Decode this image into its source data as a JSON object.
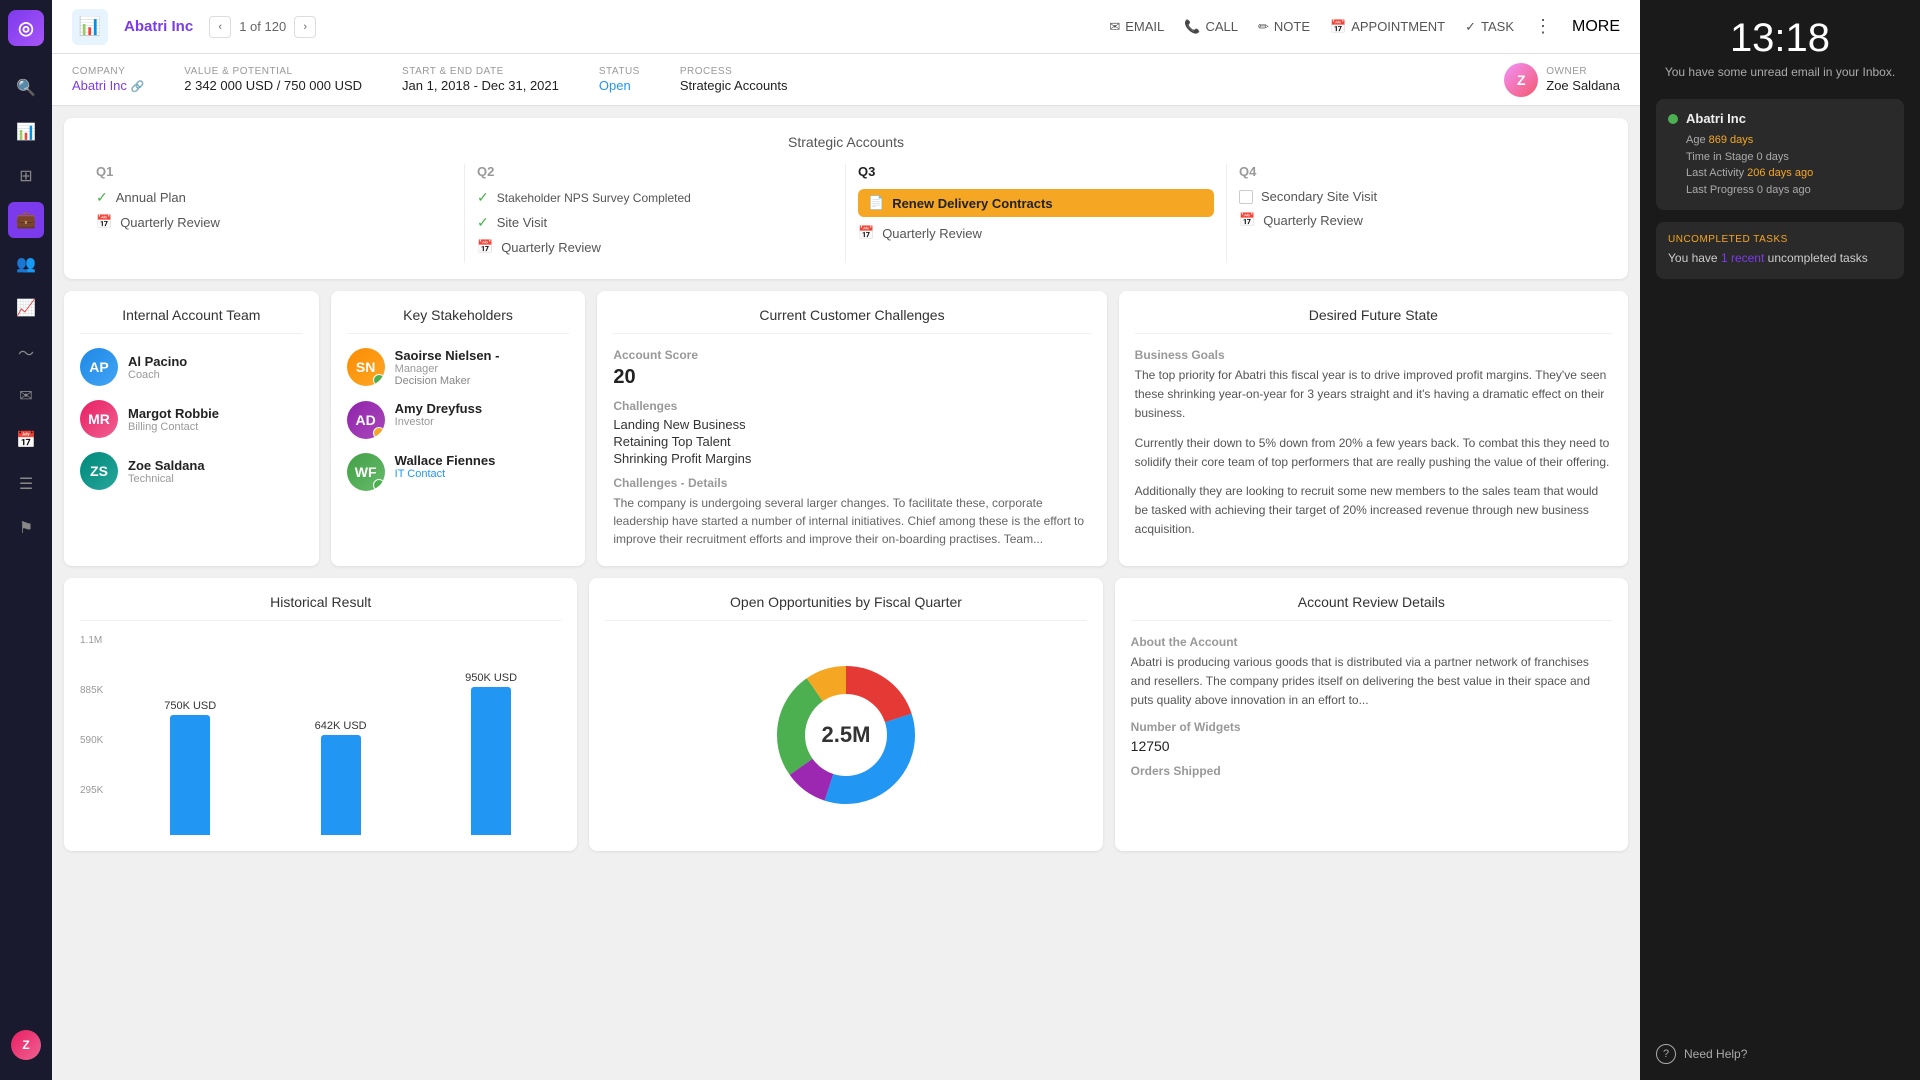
{
  "sidebar": {
    "logo": "◎",
    "icons": [
      {
        "name": "search-icon",
        "glyph": "🔍",
        "active": false
      },
      {
        "name": "chart-icon",
        "glyph": "📊",
        "active": false
      },
      {
        "name": "grid-icon",
        "glyph": "⊞",
        "active": false
      },
      {
        "name": "briefcase-icon",
        "glyph": "💼",
        "active": true
      },
      {
        "name": "people-icon",
        "glyph": "👥",
        "active": false
      },
      {
        "name": "bar-chart-icon",
        "glyph": "📈",
        "active": false
      },
      {
        "name": "pulse-icon",
        "glyph": "💓",
        "active": false
      },
      {
        "name": "mail-icon",
        "glyph": "✉",
        "active": false
      },
      {
        "name": "calendar-icon",
        "glyph": "📅",
        "active": false
      },
      {
        "name": "list-icon",
        "glyph": "☰",
        "active": false
      },
      {
        "name": "flag-icon",
        "glyph": "⚑",
        "active": false
      }
    ]
  },
  "topbar": {
    "account_name": "Abatri Inc",
    "nav_current": "1",
    "nav_total": "120",
    "actions": [
      {
        "name": "email-action",
        "label": "EMAIL",
        "icon": "✉"
      },
      {
        "name": "call-action",
        "label": "CALL",
        "icon": "📞"
      },
      {
        "name": "note-action",
        "label": "NOTE",
        "icon": "✏"
      },
      {
        "name": "appointment-action",
        "label": "APPOINTMENT",
        "icon": "📅"
      },
      {
        "name": "task-action",
        "label": "TASK",
        "icon": "✓"
      },
      {
        "name": "more-action",
        "label": "MORE",
        "icon": "⋮"
      }
    ]
  },
  "metadata": {
    "company_label": "COMPANY",
    "company_value": "Abatri Inc",
    "value_label": "VALUE & POTENTIAL",
    "value_value": "2 342 000 USD / 750 000 USD",
    "date_label": "START & END DATE",
    "date_value": "Jan 1, 2018 - Dec 31, 2021",
    "status_label": "STATUS",
    "status_value": "Open",
    "process_label": "PROCESS",
    "process_value": "Strategic Accounts",
    "owner_label": "OWNER",
    "owner_value": "Zoe Saldana"
  },
  "strategic": {
    "title": "Strategic Accounts",
    "quarters": [
      {
        "label": "Q1",
        "active": false,
        "items": [
          {
            "type": "check",
            "label": "Annual Plan"
          },
          {
            "type": "calendar",
            "label": "Quarterly Review"
          }
        ]
      },
      {
        "label": "Q2",
        "active": false,
        "items": [
          {
            "type": "check",
            "label": "Stakeholder NPS Survey Completed"
          },
          {
            "type": "check",
            "label": "Site Visit"
          },
          {
            "type": "calendar",
            "label": "Quarterly Review"
          }
        ]
      },
      {
        "label": "Q3",
        "active": true,
        "items": [
          {
            "type": "highlight",
            "label": "Renew Delivery Contracts"
          },
          {
            "type": "calendar",
            "label": "Quarterly Review"
          }
        ]
      },
      {
        "label": "Q4",
        "active": false,
        "items": [
          {
            "type": "empty",
            "label": "Secondary Site Visit"
          },
          {
            "type": "calendar",
            "label": "Quarterly Review"
          }
        ]
      }
    ]
  },
  "internal_team": {
    "title": "Internal Account Team",
    "members": [
      {
        "name": "Al Pacino",
        "role": "Coach",
        "initials": "AP",
        "color": "av-blue"
      },
      {
        "name": "Margot Robbie",
        "role": "Billing Contact",
        "initials": "MR",
        "color": "av-pink"
      },
      {
        "name": "Zoe Saldana",
        "role": "Technical",
        "initials": "ZS",
        "color": "av-teal"
      }
    ]
  },
  "key_stakeholders": {
    "title": "Key Stakeholders",
    "members": [
      {
        "name": "Saoirse Nielsen",
        "title": "Manager",
        "tag": "Decision Maker",
        "initials": "SN",
        "color": "av-orange",
        "badge_color": "#4CAF50"
      },
      {
        "name": "Amy Dreyfuss",
        "title": "Investor",
        "tag": "",
        "initials": "AD",
        "color": "av-purple",
        "badge_color": "#f5a623"
      },
      {
        "name": "Wallace Fiennes",
        "title": "IT Contact",
        "tag": "",
        "initials": "WF",
        "color": "av-green",
        "badge_color": "#4CAF50"
      }
    ]
  },
  "challenges": {
    "title": "Current Customer Challenges",
    "account_score_label": "Account Score",
    "account_score": "20",
    "challenges_label": "Challenges",
    "challenges_list": [
      "Landing New Business",
      "Retaining Top Talent",
      "Shrinking Profit Margins"
    ],
    "details_label": "Challenges - Details",
    "details_text": "The company is undergoing several larger changes. To facilitate these, corporate leadership have started a number of internal initiatives. Chief among these is the effort to improve their recruitment efforts and improve their on-boarding practises. Team..."
  },
  "desired_future": {
    "title": "Desired Future State",
    "goals_label": "Business Goals",
    "goals_text1": "The top priority for Abatri this fiscal year is to drive improved profit margins. They've seen these shrinking year-on-year for 3 years straight and it's having a dramatic effect on their business.",
    "goals_text2": "Currently their down to 5% down from 20% a few years back. To combat this they need to solidify their core team of top performers that are really pushing the value of their offering.",
    "goals_text3": "Additionally they are looking to recruit some new members to the sales team that would be tasked with achieving their target of 20% increased revenue through new business acquisition."
  },
  "historical": {
    "title": "Historical Result",
    "bars": [
      {
        "label_top": "750K USD",
        "label_bottom": "",
        "height_pct": 68
      },
      {
        "label_top": "642K USD",
        "label_bottom": "",
        "height_pct": 58
      },
      {
        "label_top": "950K USD",
        "label_bottom": "",
        "height_pct": 86
      }
    ],
    "y_labels": [
      "1.1M",
      "885K",
      "590K",
      "295K",
      ""
    ]
  },
  "opportunities": {
    "title": "Open Opportunities by Fiscal Quarter",
    "total": "2.5M",
    "segments": [
      {
        "color": "#e53935",
        "pct": 20
      },
      {
        "color": "#2196F3",
        "pct": 35
      },
      {
        "color": "#9c27b0",
        "pct": 10
      },
      {
        "color": "#4CAF50",
        "pct": 25
      },
      {
        "color": "#f5a623",
        "pct": 10
      }
    ]
  },
  "account_review": {
    "title": "Account Review Details",
    "about_label": "About the Account",
    "about_text": "Abatri is producing various goods that is distributed via a partner network of franchises and resellers. The company prides itself on delivering the best value in their space and puts quality above innovation in an effort to...",
    "widgets_label": "Number of Widgets",
    "widgets_value": "12750",
    "shipped_label": "Orders Shipped"
  },
  "right_panel": {
    "time": "13:18",
    "subtitle": "You have some unread email in your Inbox.",
    "notification": {
      "name": "Abatri Inc",
      "details": [
        {
          "label": "Age",
          "value": "869 days"
        },
        {
          "label": "Time in Stage",
          "value": "0 days"
        },
        {
          "label": "Last Activity",
          "value": "206 days ago"
        },
        {
          "label": "Last Progress",
          "value": "0 days ago"
        }
      ]
    },
    "tasks": {
      "label": "UNCOMPLETED TASKS",
      "text": "You have",
      "count": "1 recent",
      "text2": "uncompleted tasks"
    },
    "help": "Need Help?"
  }
}
